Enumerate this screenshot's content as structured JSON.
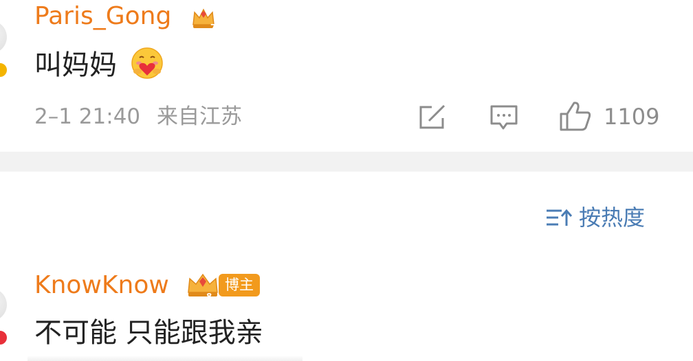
{
  "comments": [
    {
      "username": "Paris_Gong",
      "level_badge": "7",
      "text": "叫妈妈",
      "emoji": "hugging-heart-emoji",
      "time": "2–1 21:40",
      "location": "来自江苏",
      "likes": "1109"
    },
    {
      "username": "KnowKnow",
      "level_badge": "8",
      "role_badge": "博主",
      "text": "不可能 只能跟我亲"
    }
  ],
  "sort": {
    "label": "按热度",
    "icon": "sort-icon"
  },
  "colors": {
    "username": "#ee7b1b",
    "meta": "#9a9a9a",
    "sort_link": "#4a7cb4",
    "divider": "#f2f2f2",
    "badge": "#f29a1d"
  }
}
